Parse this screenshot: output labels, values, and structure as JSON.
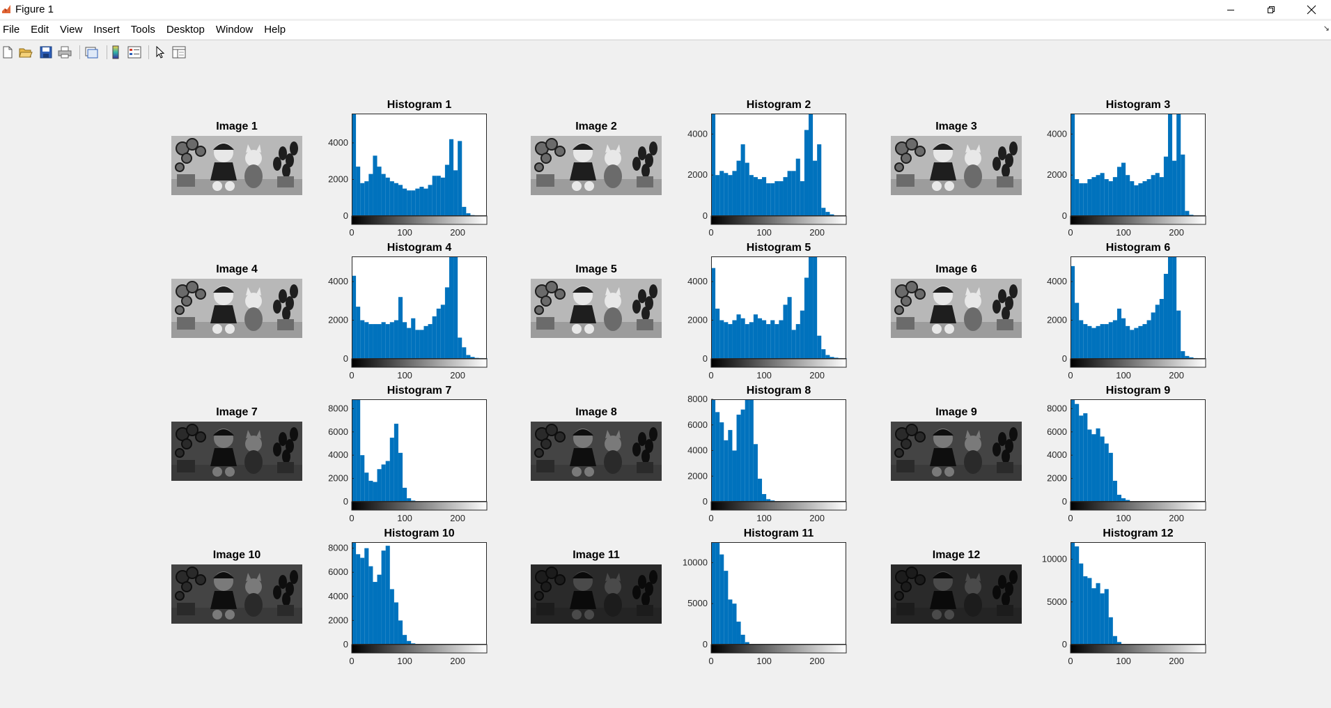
{
  "window": {
    "title": "Figure 1",
    "controls": [
      "minimize",
      "restore",
      "close"
    ]
  },
  "menu": [
    "File",
    "Edit",
    "View",
    "Insert",
    "Tools",
    "Desktop",
    "Window",
    "Help"
  ],
  "toolbar": {
    "icons": [
      "new-figure-icon",
      "open-file-icon",
      "save-icon",
      "print-icon",
      "link-plot-icon",
      "insert-colorbar-icon",
      "insert-legend-icon",
      "edit-plot-icon",
      "property-inspector-icon"
    ]
  },
  "colors": {
    "histogram_fill": "#0072bd",
    "figure_background": "#f0f0f0",
    "axes_background": "#ffffff"
  },
  "images": [
    {
      "title": "Image 1",
      "brightness": "bright"
    },
    {
      "title": "Image 2",
      "brightness": "bright"
    },
    {
      "title": "Image 3",
      "brightness": "bright"
    },
    {
      "title": "Image 4",
      "brightness": "bright"
    },
    {
      "title": "Image 5",
      "brightness": "bright"
    },
    {
      "title": "Image 6",
      "brightness": "bright"
    },
    {
      "title": "Image 7",
      "brightness": "dark"
    },
    {
      "title": "Image 8",
      "brightness": "dark"
    },
    {
      "title": "Image 9",
      "brightness": "dark"
    },
    {
      "title": "Image 10",
      "brightness": "dark"
    },
    {
      "title": "Image 11",
      "brightness": "very-dark"
    },
    {
      "title": "Image 12",
      "brightness": "very-dark"
    }
  ],
  "chart_data": [
    {
      "type": "bar",
      "title": "Histogram 1",
      "xlim": [
        0,
        255
      ],
      "ylim": [
        0,
        5600
      ],
      "xticks": [
        0,
        100,
        200
      ],
      "yticks": [
        0,
        2000,
        4000
      ],
      "x": [
        0,
        8,
        16,
        24,
        32,
        40,
        48,
        56,
        64,
        72,
        80,
        88,
        96,
        104,
        112,
        120,
        128,
        136,
        144,
        152,
        160,
        168,
        176,
        184,
        192,
        200,
        208,
        216,
        224,
        232,
        240,
        248
      ],
      "values": [
        5600,
        2700,
        1800,
        1900,
        2300,
        3300,
        2700,
        2300,
        2100,
        1900,
        1800,
        1700,
        1500,
        1400,
        1400,
        1500,
        1600,
        1500,
        1700,
        2200,
        2200,
        2100,
        2800,
        4200,
        2500,
        4100,
        500,
        150,
        50,
        20,
        10,
        0
      ]
    },
    {
      "type": "bar",
      "title": "Histogram 2",
      "xlim": [
        0,
        255
      ],
      "ylim": [
        0,
        5000
      ],
      "xticks": [
        0,
        100,
        200
      ],
      "yticks": [
        0,
        2000,
        4000
      ],
      "x": [
        0,
        8,
        16,
        24,
        32,
        40,
        48,
        56,
        64,
        72,
        80,
        88,
        96,
        104,
        112,
        120,
        128,
        136,
        144,
        152,
        160,
        168,
        176,
        184,
        192,
        200,
        208,
        216,
        224,
        232,
        240,
        248
      ],
      "values": [
        5000,
        2000,
        2200,
        2100,
        2000,
        2200,
        2700,
        3500,
        2600,
        2000,
        1900,
        1800,
        1900,
        1600,
        1600,
        1700,
        1700,
        1900,
        2200,
        2200,
        2800,
        1700,
        4200,
        5000,
        2700,
        3500,
        400,
        200,
        80,
        30,
        10,
        0
      ]
    },
    {
      "type": "bar",
      "title": "Histogram 3",
      "xlim": [
        0,
        255
      ],
      "ylim": [
        0,
        5000
      ],
      "xticks": [
        0,
        100,
        200
      ],
      "yticks": [
        0,
        2000,
        4000
      ],
      "x": [
        0,
        8,
        16,
        24,
        32,
        40,
        48,
        56,
        64,
        72,
        80,
        88,
        96,
        104,
        112,
        120,
        128,
        136,
        144,
        152,
        160,
        168,
        176,
        184,
        192,
        200,
        208,
        216,
        224,
        232,
        240,
        248
      ],
      "values": [
        5000,
        1800,
        1600,
        1600,
        1800,
        1900,
        2000,
        2100,
        1800,
        1700,
        1900,
        2400,
        2600,
        2000,
        1700,
        1500,
        1600,
        1700,
        1800,
        2000,
        2100,
        1900,
        2900,
        5000,
        2700,
        5000,
        3000,
        250,
        60,
        20,
        10,
        0
      ]
    },
    {
      "type": "bar",
      "title": "Histogram 4",
      "xlim": [
        0,
        255
      ],
      "ylim": [
        0,
        5300
      ],
      "xticks": [
        0,
        100,
        200
      ],
      "yticks": [
        0,
        2000,
        4000
      ],
      "x": [
        0,
        8,
        16,
        24,
        32,
        40,
        48,
        56,
        64,
        72,
        80,
        88,
        96,
        104,
        112,
        120,
        128,
        136,
        144,
        152,
        160,
        168,
        176,
        184,
        192,
        200,
        208,
        216,
        224,
        232,
        240,
        248
      ],
      "values": [
        4300,
        2700,
        2000,
        1900,
        1800,
        1800,
        1800,
        1900,
        1800,
        1900,
        2000,
        3200,
        1900,
        1600,
        2100,
        1500,
        1500,
        1700,
        1800,
        2200,
        2600,
        2800,
        3700,
        5300,
        5300,
        1100,
        600,
        200,
        100,
        50,
        40,
        30
      ]
    },
    {
      "type": "bar",
      "title": "Histogram 5",
      "xlim": [
        0,
        255
      ],
      "ylim": [
        0,
        5300
      ],
      "xticks": [
        0,
        100,
        200
      ],
      "yticks": [
        0,
        2000,
        4000
      ],
      "x": [
        0,
        8,
        16,
        24,
        32,
        40,
        48,
        56,
        64,
        72,
        80,
        88,
        96,
        104,
        112,
        120,
        128,
        136,
        144,
        152,
        160,
        168,
        176,
        184,
        192,
        200,
        208,
        216,
        224,
        232,
        240,
        248
      ],
      "values": [
        4700,
        2600,
        2000,
        1900,
        1800,
        2000,
        2300,
        2100,
        1800,
        1900,
        2300,
        2100,
        2000,
        1800,
        2000,
        1800,
        2000,
        2800,
        3200,
        1500,
        1800,
        2500,
        4200,
        5300,
        5300,
        1200,
        500,
        200,
        100,
        60,
        40,
        30
      ]
    },
    {
      "type": "bar",
      "title": "Histogram 6",
      "xlim": [
        0,
        255
      ],
      "ylim": [
        0,
        5300
      ],
      "xticks": [
        0,
        100,
        200
      ],
      "yticks": [
        0,
        2000,
        4000
      ],
      "x": [
        0,
        8,
        16,
        24,
        32,
        40,
        48,
        56,
        64,
        72,
        80,
        88,
        96,
        104,
        112,
        120,
        128,
        136,
        144,
        152,
        160,
        168,
        176,
        184,
        192,
        200,
        208,
        216,
        224,
        232,
        240,
        248
      ],
      "values": [
        4800,
        2900,
        2000,
        1800,
        1700,
        1600,
        1700,
        1800,
        1800,
        1900,
        2000,
        2600,
        2100,
        1700,
        1500,
        1600,
        1700,
        1800,
        2000,
        2400,
        2800,
        3100,
        4400,
        5300,
        5300,
        2500,
        400,
        150,
        80,
        40,
        30,
        20
      ]
    },
    {
      "type": "bar",
      "title": "Histogram 7",
      "xlim": [
        0,
        255
      ],
      "ylim": [
        0,
        8800
      ],
      "xticks": [
        0,
        100,
        200
      ],
      "yticks": [
        0,
        2000,
        4000,
        6000,
        8000
      ],
      "x": [
        0,
        8,
        16,
        24,
        32,
        40,
        48,
        56,
        64,
        72,
        80,
        88,
        96,
        104,
        112,
        120,
        128,
        136,
        144,
        152,
        160,
        168,
        176,
        184,
        192,
        200,
        208,
        216,
        224,
        232,
        240,
        248
      ],
      "values": [
        8800,
        8800,
        4000,
        2500,
        1800,
        1700,
        2800,
        3200,
        3500,
        5500,
        6700,
        4200,
        1200,
        300,
        100,
        40,
        10,
        0,
        0,
        0,
        0,
        0,
        0,
        0,
        0,
        0,
        0,
        0,
        0,
        0,
        0,
        0
      ]
    },
    {
      "type": "bar",
      "title": "Histogram 8",
      "xlim": [
        0,
        255
      ],
      "ylim": [
        0,
        8000
      ],
      "xticks": [
        0,
        100,
        200
      ],
      "yticks": [
        0,
        2000,
        4000,
        6000,
        8000
      ],
      "x": [
        0,
        8,
        16,
        24,
        32,
        40,
        48,
        56,
        64,
        72,
        80,
        88,
        96,
        104,
        112,
        120,
        128,
        136,
        144,
        152,
        160,
        168,
        176,
        184,
        192,
        200,
        208,
        216,
        224,
        232,
        240,
        248
      ],
      "values": [
        8000,
        7000,
        6200,
        4800,
        5600,
        4000,
        6800,
        7200,
        8000,
        8000,
        4500,
        1800,
        600,
        200,
        100,
        50,
        20,
        0,
        0,
        0,
        0,
        0,
        0,
        0,
        0,
        0,
        0,
        0,
        0,
        0,
        0,
        0
      ]
    },
    {
      "type": "bar",
      "title": "Histogram 9",
      "xlim": [
        0,
        255
      ],
      "ylim": [
        0,
        8800
      ],
      "xticks": [
        0,
        100,
        200
      ],
      "yticks": [
        0,
        2000,
        4000,
        6000,
        8000
      ],
      "x": [
        0,
        8,
        16,
        24,
        32,
        40,
        48,
        56,
        64,
        72,
        80,
        88,
        96,
        104,
        112,
        120,
        128,
        136,
        144,
        152,
        160,
        168,
        176,
        184,
        192,
        200,
        208,
        216,
        224,
        232,
        240,
        248
      ],
      "values": [
        8800,
        8400,
        7400,
        7600,
        6200,
        5800,
        6300,
        5600,
        5000,
        4200,
        1800,
        600,
        300,
        150,
        60,
        20,
        0,
        0,
        0,
        0,
        0,
        0,
        0,
        0,
        0,
        0,
        0,
        0,
        0,
        0,
        0,
        0
      ]
    },
    {
      "type": "bar",
      "title": "Histogram 10",
      "xlim": [
        0,
        255
      ],
      "ylim": [
        0,
        8500
      ],
      "xticks": [
        0,
        100,
        200
      ],
      "yticks": [
        0,
        2000,
        4000,
        6000,
        8000
      ],
      "x": [
        0,
        8,
        16,
        24,
        32,
        40,
        48,
        56,
        64,
        72,
        80,
        88,
        96,
        104,
        112,
        120,
        128,
        136,
        144,
        152,
        160,
        168,
        176,
        184,
        192,
        200,
        208,
        216,
        224,
        232,
        240,
        248
      ],
      "values": [
        8500,
        7500,
        7200,
        8000,
        6500,
        5200,
        5800,
        7800,
        8200,
        4600,
        3500,
        2000,
        800,
        300,
        100,
        40,
        10,
        0,
        0,
        0,
        0,
        0,
        0,
        0,
        0,
        0,
        0,
        0,
        0,
        0,
        0,
        0
      ]
    },
    {
      "type": "bar",
      "title": "Histogram 11",
      "xlim": [
        0,
        255
      ],
      "ylim": [
        0,
        12500
      ],
      "xticks": [
        0,
        100,
        200
      ],
      "yticks": [
        0,
        5000,
        10000
      ],
      "x": [
        0,
        8,
        16,
        24,
        32,
        40,
        48,
        56,
        64,
        72,
        80,
        88,
        96,
        104,
        112,
        120,
        128,
        136,
        144,
        152,
        160,
        168,
        176,
        184,
        192,
        200,
        208,
        216,
        224,
        232,
        240,
        248
      ],
      "values": [
        12500,
        12500,
        11000,
        9000,
        5500,
        5000,
        2800,
        1200,
        300,
        80,
        20,
        0,
        0,
        0,
        0,
        0,
        0,
        0,
        0,
        0,
        0,
        0,
        0,
        0,
        0,
        0,
        0,
        0,
        0,
        0,
        0,
        0
      ]
    },
    {
      "type": "bar",
      "title": "Histogram 12",
      "xlim": [
        0,
        255
      ],
      "ylim": [
        0,
        12000
      ],
      "xticks": [
        0,
        100,
        200
      ],
      "yticks": [
        0,
        5000,
        10000
      ],
      "x": [
        0,
        8,
        16,
        24,
        32,
        40,
        48,
        56,
        64,
        72,
        80,
        88,
        96,
        104,
        112,
        120,
        128,
        136,
        144,
        152,
        160,
        168,
        176,
        184,
        192,
        200,
        208,
        216,
        224,
        232,
        240,
        248
      ],
      "values": [
        12000,
        11500,
        9500,
        8000,
        7800,
        6600,
        7200,
        6000,
        6500,
        3200,
        1000,
        300,
        80,
        20,
        0,
        0,
        0,
        0,
        0,
        0,
        0,
        0,
        0,
        0,
        0,
        0,
        0,
        0,
        0,
        0,
        0,
        0
      ]
    }
  ]
}
